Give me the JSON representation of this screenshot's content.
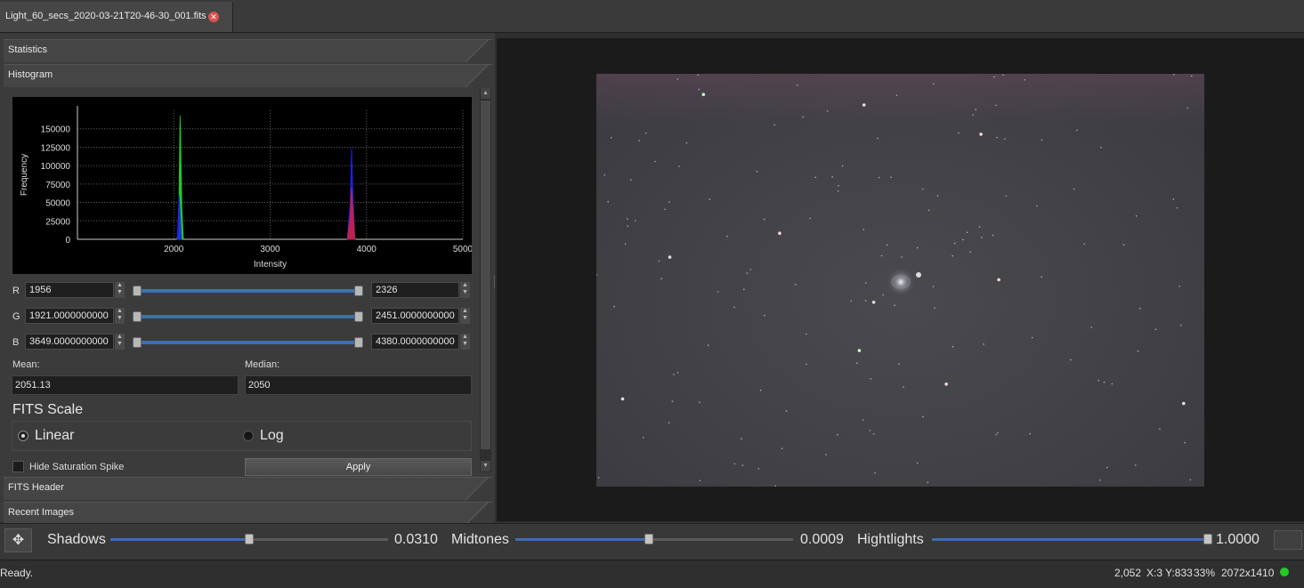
{
  "tab": {
    "title": "Light_60_secs_2020-03-21T20-46-30_001.fits",
    "close_icon": "close-icon"
  },
  "sections": {
    "statistics": "Statistics",
    "histogram": "Histogram",
    "fits_header": "FITS Header",
    "recent_images": "Recent Images"
  },
  "chart_data": {
    "type": "area",
    "xlabel": "Intensity",
    "ylabel": "Frequency",
    "xlim": [
      1000,
      5000
    ],
    "ylim": [
      0,
      175000
    ],
    "xticks": [
      "2000",
      "3000",
      "4000",
      "5000"
    ],
    "yticks": [
      "0",
      "25000",
      "50000",
      "75000",
      "100000",
      "125000",
      "150000"
    ],
    "grid": true,
    "series": [
      {
        "color": "#22dd22",
        "x": [
          2030,
          2050,
          2060,
          2065,
          2070,
          2075,
          2085,
          2100
        ],
        "values": [
          0,
          10000,
          120000,
          168000,
          150000,
          108000,
          40000,
          0
        ]
      },
      {
        "color": "#2222ee",
        "x": [
          2035,
          2055,
          2065,
          2080
        ],
        "values": [
          0,
          60000,
          40000,
          0
        ],
        "secondary_x": [
          3800,
          3830,
          3845,
          3860,
          3880
        ],
        "secondary_values": [
          0,
          50000,
          125000,
          60000,
          0
        ]
      },
      {
        "color": "#cc2244",
        "x": [
          3800,
          3830,
          3845,
          3860,
          3880
        ],
        "values": [
          0,
          30000,
          70000,
          40000,
          0
        ]
      }
    ]
  },
  "levels": {
    "r": {
      "label": "R",
      "min": "1956",
      "max": "2326"
    },
    "g": {
      "label": "G",
      "min": "1921.0000000000",
      "max": "2451.0000000000"
    },
    "b": {
      "label": "B",
      "min": "3649.0000000000",
      "max": "4380.0000000000"
    }
  },
  "stats": {
    "mean_label": "Mean:",
    "mean": "2051.13",
    "median_label": "Median:",
    "median": "2050"
  },
  "fits_scale": {
    "title": "FITS Scale",
    "linear": "Linear",
    "log": "Log",
    "selected": "linear"
  },
  "hide_spike": "Hide Saturation Spike",
  "apply": "Apply",
  "bottom": {
    "shadows_label": "Shadows",
    "shadows_value": "0.0310",
    "shadows_level": 0.5,
    "midtones_label": "Midtones",
    "midtones_value": "0.0009",
    "midtones_level": 0.48,
    "highlights_label": "Hightlights",
    "highlights_value": "1.0000",
    "highlights_level": 1.0
  },
  "status": {
    "text": "Ready.",
    "pixel_value": "2,052",
    "coords": "X:3 Y:833",
    "zoom": "33%",
    "size": "2072x1410",
    "indicator_color": "#22cc22"
  }
}
